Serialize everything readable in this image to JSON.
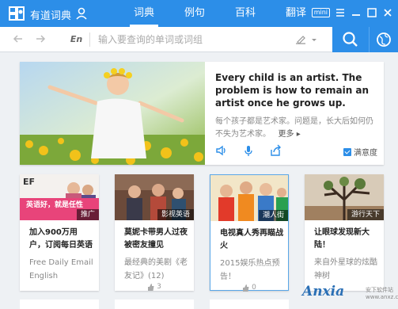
{
  "app": {
    "title": "有道词典"
  },
  "tabs": [
    {
      "label": "词典",
      "active": true
    },
    {
      "label": "例句",
      "active": false
    },
    {
      "label": "百科",
      "active": false
    },
    {
      "label": "翻译",
      "active": false
    }
  ],
  "window": {
    "mini_label": "mini"
  },
  "search": {
    "lang": "En",
    "placeholder": "输入要查询的单词或词组",
    "value": ""
  },
  "feature": {
    "quote_en": "Every child is an artist. The problem is how to remain an artist once he grows up.",
    "quote_cn": "每个孩子都是艺术家。问题是，长大后如何仍不失为艺术家。",
    "more_label": "更多",
    "satisfaction_label": "满意度"
  },
  "cards": [
    {
      "banner": "英语好，就是任性",
      "tag": "推广",
      "title": "加入900万用户，订阅每日英语",
      "desc": "Free Daily Email English",
      "likes": ""
    },
    {
      "banner": "",
      "tag": "影视英语",
      "title": "莫妮卡带男人过夜被密友撞见",
      "desc": "最经典的美剧《老友记》(12)",
      "likes": "3"
    },
    {
      "banner": "",
      "tag": "潮人街",
      "title": "电视真人秀再瞄战火",
      "desc": "2015娱乐热点预告！",
      "likes": "0"
    },
    {
      "banner": "",
      "tag": "游行天下",
      "title": "让眼球发现新大陆！",
      "desc": "来自外星球的炫酷神树",
      "likes": ""
    }
  ],
  "watermark": {
    "brand": "Anxia",
    "sub": "安下软件站",
    "url": "www.anxz.com"
  },
  "colors": {
    "accent": "#2c8ee8",
    "tag_bg": "#e8447a"
  }
}
